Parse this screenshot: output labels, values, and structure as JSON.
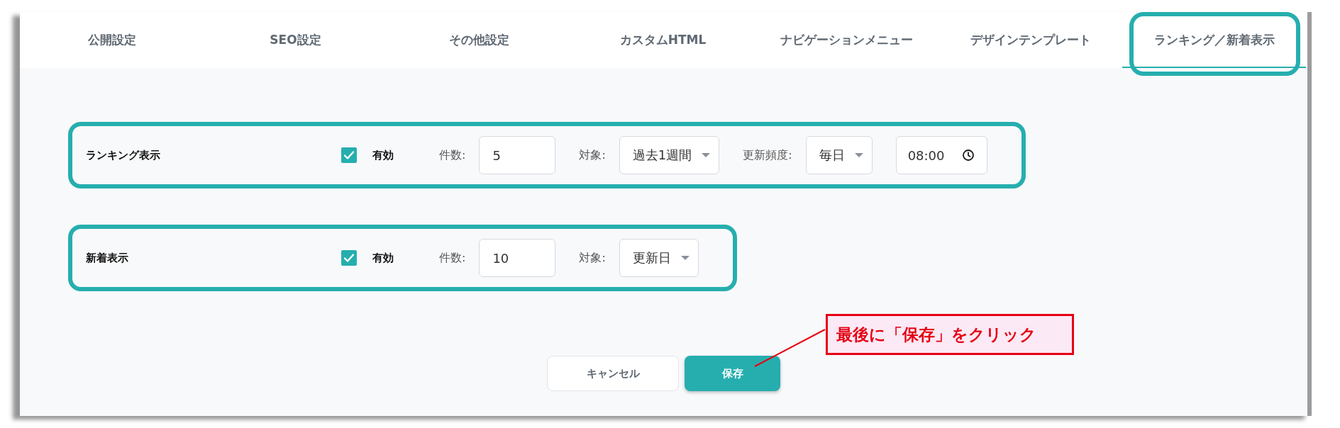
{
  "tabs": [
    {
      "label": "公開設定",
      "selected": false,
      "highlighted": false
    },
    {
      "label": "SEO設定",
      "selected": false,
      "highlighted": false
    },
    {
      "label": "その他設定",
      "selected": false,
      "highlighted": false
    },
    {
      "label": "カスタムHTML",
      "selected": false,
      "highlighted": false
    },
    {
      "label": "ナビゲーションメニュー",
      "selected": false,
      "highlighted": false
    },
    {
      "label": "デザインテンプレート",
      "selected": false,
      "highlighted": false
    },
    {
      "label": "ランキング／新着表示",
      "selected": true,
      "highlighted": true
    }
  ],
  "settings": [
    {
      "title": "ランキング表示",
      "highlighted": true,
      "enabled": true,
      "enabled_label": "有効",
      "fields": [
        {
          "kind": "number",
          "label": "件数:",
          "value": "5"
        },
        {
          "kind": "select",
          "label": "対象:",
          "value": "過去1週間"
        },
        {
          "kind": "select",
          "label": "更新頻度:",
          "value": "毎日"
        },
        {
          "kind": "time",
          "value": "08:00"
        }
      ]
    },
    {
      "title": "新着表示",
      "highlighted": true,
      "enabled": true,
      "enabled_label": "有効",
      "fields": [
        {
          "kind": "number",
          "label": "件数:",
          "value": "10"
        },
        {
          "kind": "select",
          "label": "対象:",
          "value": "更新日"
        }
      ]
    }
  ],
  "buttons": [
    {
      "kind": "secondary",
      "label": "キャンセル"
    },
    {
      "kind": "primary",
      "label": "保存"
    }
  ],
  "callout": {
    "text": "最後に「保存」をクリック"
  }
}
